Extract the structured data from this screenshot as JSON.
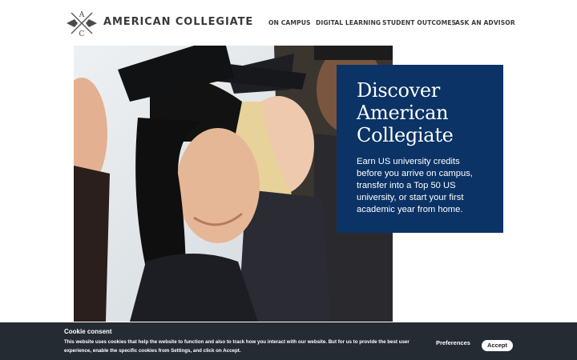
{
  "header": {
    "logo_letters": [
      "A",
      "C"
    ],
    "brand": "AMERICAN COLLEGIATE",
    "nav": [
      "ON CAMPUS",
      "DIGITAL LEARNING",
      "STUDENT OUTCOMES",
      "ASK AN ADVISOR"
    ]
  },
  "hero": {
    "title": "Discover American Collegiate",
    "body": "Earn US university credits before you arrive on campus, transfer into a Top 50 US university, or start your first academic year from home."
  },
  "cookie": {
    "title": "Cookie consent",
    "text": "This website uses cookies that help the website to function and also to track how you interact with our website. But for us to provide the best user experience, enable the specific cookies from Settings, and click on Accept.",
    "preferences_label": "Preferences",
    "accept_label": "Accept"
  },
  "colors": {
    "brand_navy": "#0b3366",
    "cookie_bar": "#252b33",
    "text_dark": "#3a3a3a"
  },
  "icons": [
    "logo-emblem-icon"
  ]
}
